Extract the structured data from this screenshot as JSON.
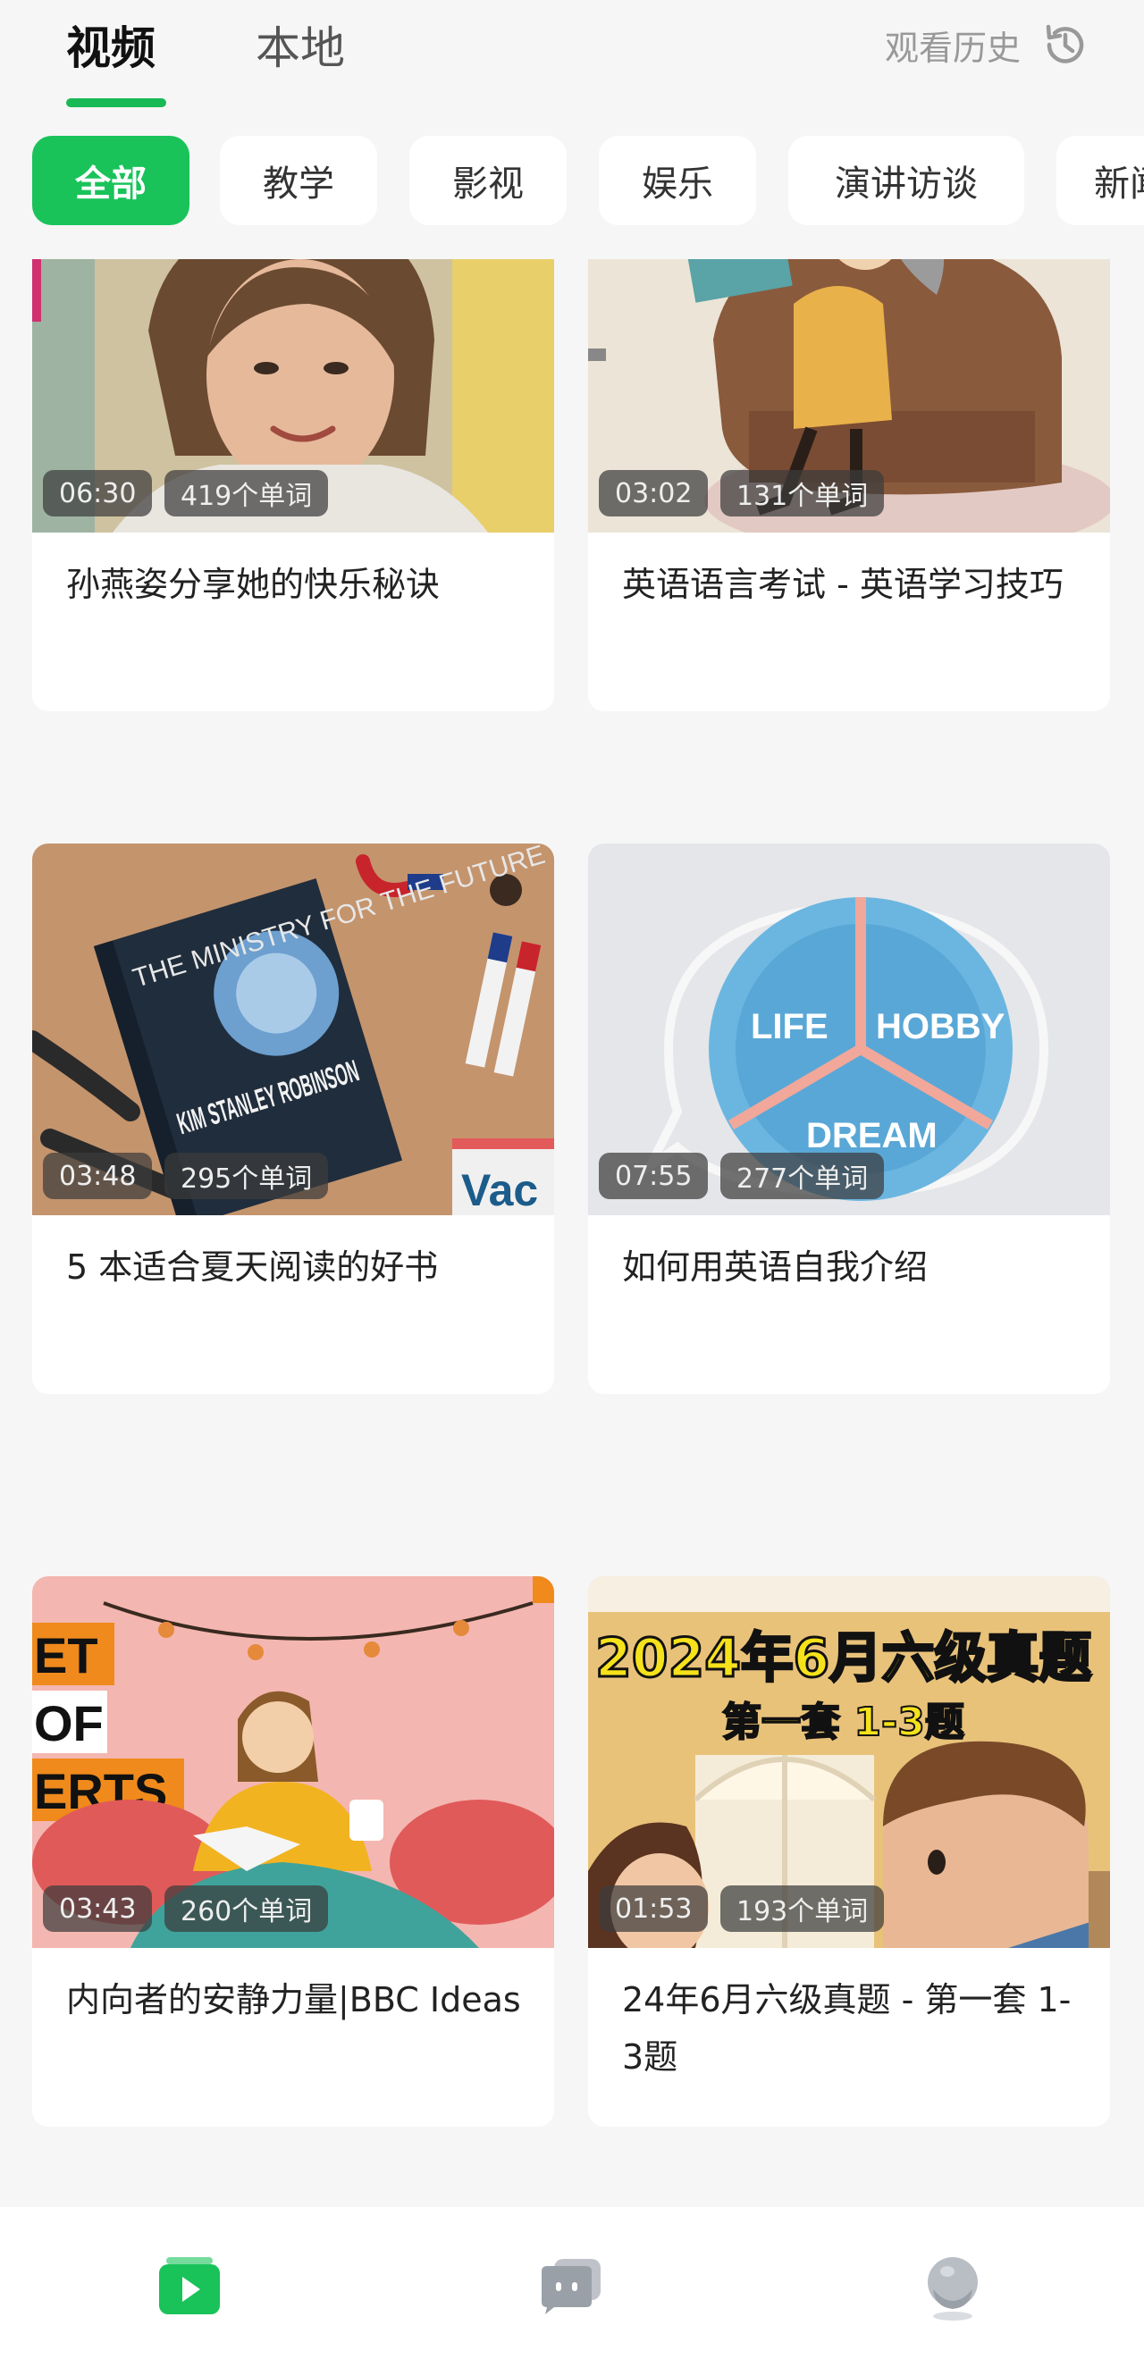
{
  "top_tabs": [
    {
      "label": "视频",
      "active": true
    },
    {
      "label": "本地",
      "active": false
    }
  ],
  "history": {
    "label": "观看历史",
    "icon": "history-clock-icon"
  },
  "categories": [
    {
      "label": "全部",
      "active": true
    },
    {
      "label": "教学",
      "active": false
    },
    {
      "label": "影视",
      "active": false
    },
    {
      "label": "娱乐",
      "active": false
    },
    {
      "label": "演讲访谈",
      "active": false
    },
    {
      "label": "新闻",
      "active": false
    }
  ],
  "videos": [
    {
      "duration": "06:30",
      "words": "419个单词",
      "title": "孙燕姿分享她的快乐秘诀"
    },
    {
      "duration": "03:02",
      "words": "131个单词",
      "title": "英语语言考试 - 英语学习技巧"
    },
    {
      "duration": "03:48",
      "words": "295个单词",
      "title": "5 本适合夏天阅读的好书",
      "thumb_text": {
        "book_title": "THE MINISTRY FOR THE FUTURE",
        "author": "KIM STANLEY ROBINSON",
        "side": "Vac"
      }
    },
    {
      "duration": "07:55",
      "words": "277个单词",
      "title": "如何用英语自我介绍",
      "thumb_text": {
        "a": "LIFE",
        "b": "HOBBY",
        "c": "DREAM"
      }
    },
    {
      "duration": "03:43",
      "words": "260个单词",
      "title": "内向者的安静力量|BBC Ideas",
      "thumb_text": {
        "l1": "ET",
        "l2": "OF",
        "l3": "ERTS"
      }
    },
    {
      "duration": "01:53",
      "words": "193个单词",
      "title": "24年6月六级真题 - 第一套 1-3题",
      "thumb_text": {
        "headline": "2024年6月六级真题",
        "sub": "第一套 1-3题"
      }
    }
  ],
  "bottom_nav": [
    {
      "icon": "video-play-icon",
      "active": true
    },
    {
      "icon": "chat-bubbles-icon",
      "active": false
    },
    {
      "icon": "profile-avatar-icon",
      "active": false
    }
  ],
  "colors": {
    "accent": "#19c35a",
    "background": "#f6f6f6"
  }
}
